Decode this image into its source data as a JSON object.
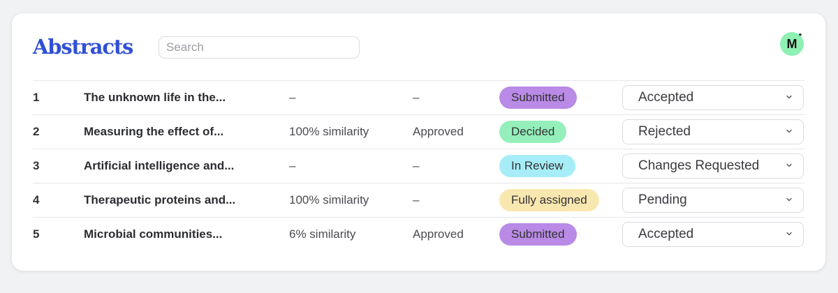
{
  "header": {
    "title": "Abstracts",
    "search_placeholder": "Search",
    "avatar_initial": "M",
    "avatar_mark": "*"
  },
  "colors": {
    "title": "#2f4fd6",
    "avatar": "#8ff0b4",
    "submitted": "#b98ae6",
    "decided": "#94efbb",
    "in_review": "#a6edf8",
    "fully_assigned": "#f9e7b0"
  },
  "rows": [
    {
      "num": "1",
      "title": "The unknown life in the...",
      "similarity": "–",
      "approval": "–",
      "status": "Submitted",
      "status_color": "#b98ae6",
      "decision": "Accepted"
    },
    {
      "num": "2",
      "title": "Measuring the effect of...",
      "similarity": "100% similarity",
      "approval": "Approved",
      "status": "Decided",
      "status_color": "#94efbb",
      "decision": "Rejected"
    },
    {
      "num": "3",
      "title": "Artificial intelligence and...",
      "similarity": "–",
      "approval": "–",
      "status": "In Review",
      "status_color": "#a6edf8",
      "decision": "Changes Requested"
    },
    {
      "num": "4",
      "title": "Therapeutic proteins and...",
      "similarity": "100% similarity",
      "approval": "–",
      "status": "Fully assigned",
      "status_color": "#f9e7b0",
      "decision": "Pending"
    },
    {
      "num": "5",
      "title": "Microbial communities...",
      "similarity": "6% similarity",
      "approval": "Approved",
      "status": "Submitted",
      "status_color": "#b98ae6",
      "decision": "Accepted"
    }
  ]
}
